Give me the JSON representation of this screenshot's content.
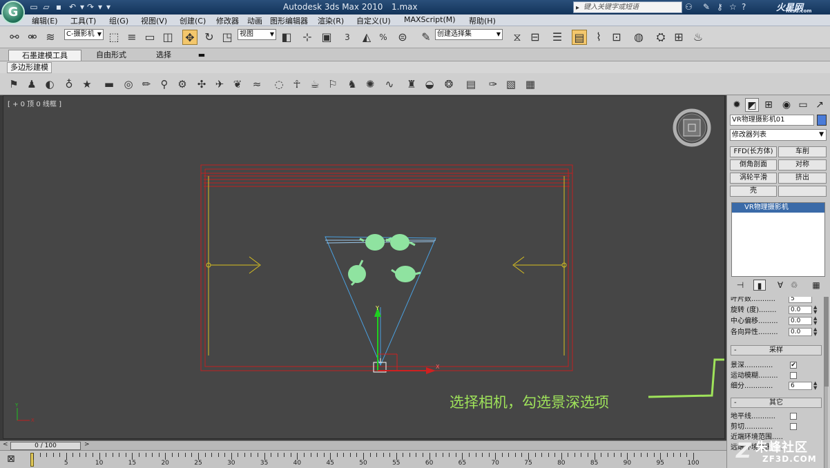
{
  "window": {
    "app_title": "Autodesk 3ds Max  2010",
    "file_name": "1.max",
    "help_search_placeholder": "键入关键字或短语",
    "brand_logo": "火星网",
    "brand_logo_sub": "hxsd.com"
  },
  "menu": [
    "编辑(E)",
    "工具(T)",
    "组(G)",
    "视图(V)",
    "创建(C)",
    "修改器",
    "动画",
    "图形编辑器",
    "渲染(R)",
    "自定义(U)",
    "MAXScript(M)",
    "帮助(H)"
  ],
  "main_toolbar": {
    "selection_filter": "C-摄影机",
    "reference_coord": "视图",
    "named_selection": "创建选择集",
    "snap_angle": "3",
    "snap_percent": "%"
  },
  "ribbon": {
    "tabs": [
      "石墨建模工具",
      "自由形式",
      "选择"
    ],
    "active_tab": "石墨建模工具",
    "panel_label": "多边形建模"
  },
  "viewport": {
    "label": "[ + 0 顶 0 线框 ]",
    "annotation": "选择相机，勾选景深选项",
    "colors": {
      "background": "#464646",
      "room": "#c02020",
      "light": "#d8c020",
      "camera": "#4aa0e0",
      "teapot": "#8fe3a0",
      "annotation": "#9fe35a"
    }
  },
  "command_panel": {
    "object_name": "VR物理摄影机01",
    "object_color": "#4a7bd8",
    "modifier_list": "修改器列表",
    "modifier_buttons": [
      "FFD(长方体)",
      "车削",
      "倒角剖面",
      "对称",
      "涡轮平滑",
      "挤出",
      "壳",
      ""
    ],
    "stack_item": "VR物理摄影机",
    "params_top": [
      {
        "label": "叶片数...........",
        "value": "5"
      },
      {
        "label": "旋转 (度)........",
        "value": "0.0"
      },
      {
        "label": "中心偏移.........",
        "value": "0.0"
      },
      {
        "label": "各向异性.........",
        "value": "0.0"
      }
    ],
    "sampling_title": "采样",
    "depth_of_field_label": "景深.............",
    "depth_of_field_checked": "✔",
    "motion_blur_label": "运动模糊.........",
    "subdivs_label": "细分.............",
    "subdivs_value": "6",
    "misc_title": "其它",
    "horizon_label": "地平线...........",
    "clipping_label": "剪切.............",
    "near_env_label": "近端环境范围.....",
    "far_env_label": "远端环境范围....."
  },
  "timeline": {
    "frame_display": "0 / 100",
    "ticks": [
      "5",
      "10",
      "15",
      "20",
      "25",
      "30",
      "35",
      "40",
      "45",
      "50",
      "55",
      "60",
      "65",
      "70",
      "75",
      "80",
      "85",
      "90",
      "95",
      "100"
    ]
  },
  "watermark": {
    "cn": "朱峰社区",
    "en": "ZF3D.COM",
    "z": "Z"
  }
}
